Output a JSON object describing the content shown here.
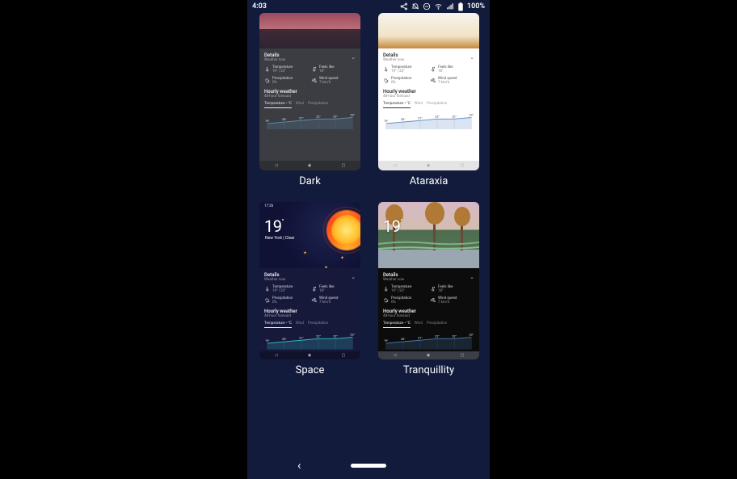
{
  "status": {
    "time": "4:03",
    "battery": "100%"
  },
  "themes": [
    {
      "key": "dark",
      "name": "Dark"
    },
    {
      "key": "atar",
      "name": "Ataraxia"
    },
    {
      "key": "space",
      "name": "Space"
    },
    {
      "key": "tranq",
      "name": "Tranquillity"
    }
  ],
  "main_weather": {
    "temp": 19,
    "unit": "°",
    "city": "New York",
    "condition": "Clear",
    "mini_time": "17:26"
  },
  "details": {
    "heading": "Details",
    "sub": "Weather now",
    "items": [
      {
        "icon": "therm",
        "k": "Temperature",
        "v": "19° | 23°"
      },
      {
        "icon": "therm2",
        "k": "Feels like",
        "v": "18°"
      },
      {
        "icon": "precip",
        "k": "Precipitation",
        "v": "0%"
      },
      {
        "icon": "wind",
        "k": "Wind speed",
        "v": "7 km/h"
      }
    ]
  },
  "hourly": {
    "heading": "Hourly weather",
    "sub": "48-hour forecast",
    "tabs": [
      "Temperature • °C",
      "Wind",
      "Precipitation"
    ],
    "active_tab": 0
  },
  "chart_data": {
    "type": "line",
    "categories": [
      "19°",
      "20°",
      "21°",
      "22°",
      "22°",
      "23°"
    ],
    "values": [
      19,
      20,
      21,
      22,
      22,
      23
    ],
    "ylim": [
      17,
      25
    ]
  },
  "nav_icons": [
    "back",
    "home",
    "recents"
  ]
}
